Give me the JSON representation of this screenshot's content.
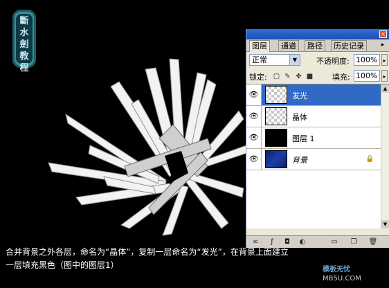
{
  "seal": {
    "text": "斷水劍教程"
  },
  "panel": {
    "tabs": [
      "图层",
      "通道",
      "路径",
      "历史记录"
    ],
    "blend_mode": "正常",
    "opacity_label": "不透明度:",
    "opacity_value": "100%",
    "lock_label": "锁定:",
    "fill_label": "填充:",
    "fill_value": "100%",
    "layers": [
      {
        "name": "发光",
        "thumb": "checker",
        "selected": true
      },
      {
        "name": "晶体",
        "thumb": "checker",
        "selected": false
      },
      {
        "name": "图层 1",
        "thumb": "black",
        "selected": false
      },
      {
        "name": "背景",
        "thumb": "blue",
        "selected": false,
        "locked": true
      }
    ]
  },
  "caption": "合并背景之外各层，命名为“晶体”，复制一层命名为“发光”，在背景上面建立\n一层填充黑色（图中的图层1）",
  "watermark": {
    "line1": "模板无忧",
    "line2": "MB5U.COM"
  }
}
